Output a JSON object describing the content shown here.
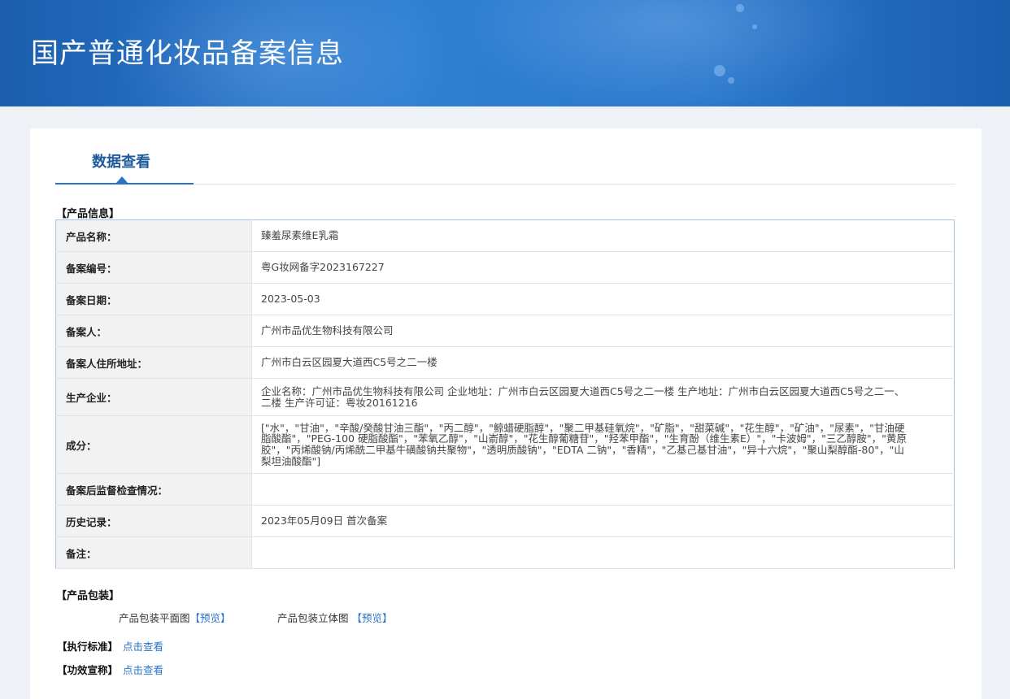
{
  "page_title": "国产普通化妆品备案信息",
  "tab_label": "数据查看",
  "product_info": {
    "section_label": "【产品信息】",
    "rows": [
      {
        "label": "产品名称：",
        "value": "臻羞尿素维E乳霜"
      },
      {
        "label": "备案编号：",
        "value": "粤G妆网备字2023167227"
      },
      {
        "label": "备案日期：",
        "value": "2023-05-03"
      },
      {
        "label": "备案人：",
        "value": "广州市品优生物科技有限公司"
      },
      {
        "label": "备案人住所地址：",
        "value": "广州市白云区园夏大道西C5号之二一楼"
      },
      {
        "label": "生产企业：",
        "value": "企业名称：广州市品优生物科技有限公司 企业地址：广州市白云区园夏大道西C5号之二一楼 生产地址：广州市白云区园夏大道西C5号之二一、二楼 生产许可证：粤妆20161216"
      },
      {
        "label": "成分：",
        "value": "[\"水\"，\"甘油\"，\"辛酸/癸酸甘油三酯\"，\"丙二醇\"，\"鲸蜡硬脂醇\"，\"聚二甲基硅氧烷\"，\"矿脂\"，\"甜菜碱\"，\"花生醇\"，\"矿油\"，\"尿素\"，\"甘油硬脂酸酯\"，\"PEG-100 硬脂酸酯\"，\"苯氧乙醇\"，\"山嵛醇\"，\"花生醇葡糖苷\"，\"羟苯甲酯\"，\"生育酚（维生素E）\"，\"卡波姆\"，\"三乙醇胺\"，\"黄原胶\"，\"丙烯酸钠/丙烯酰二甲基牛磺酸钠共聚物\"，\"透明质酸钠\"，\"EDTA 二钠\"，\"香精\"，\"乙基己基甘油\"，\"异十六烷\"，\"聚山梨醇酯-80\"，\"山梨坦油酸酯\"]"
      },
      {
        "label": "备案后监督检查情况：",
        "value": ""
      },
      {
        "label": "历史记录：",
        "value": "2023年05月09日 首次备案"
      },
      {
        "label": "备注：",
        "value": ""
      }
    ]
  },
  "packaging": {
    "section_label": "【产品包装】",
    "flat_label": "产品包装平面图",
    "stereo_label": "产品包装立体图",
    "preview_link": "【预览】"
  },
  "standard": {
    "label": "【执行标准】",
    "link": "点击查看"
  },
  "efficacy": {
    "label": "【功效宣称】",
    "link": "点击查看"
  }
}
